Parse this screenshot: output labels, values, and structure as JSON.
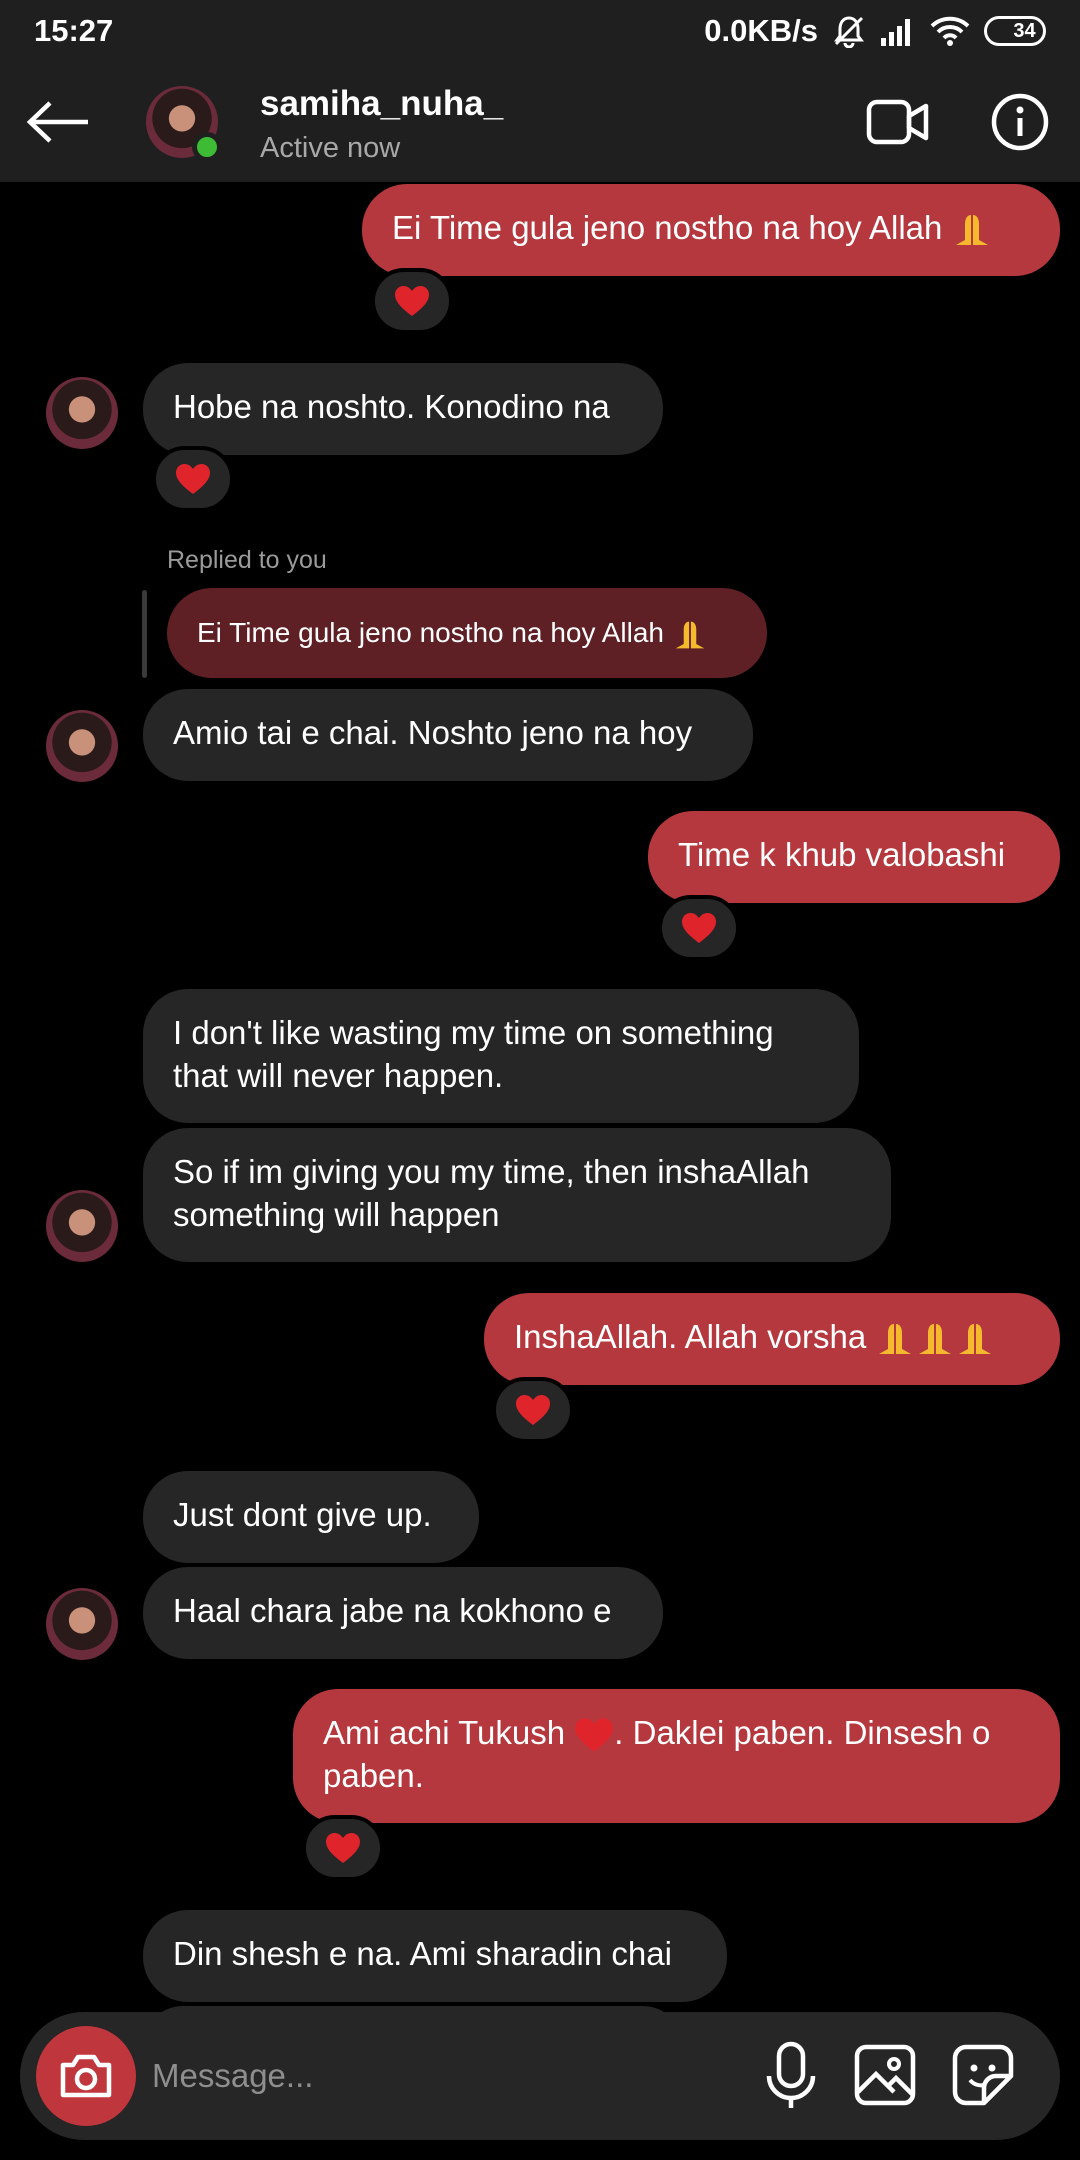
{
  "status_bar": {
    "time": "15:27",
    "network_speed": "0.0KB/s",
    "battery": "34",
    "battery_level": 0.34
  },
  "header": {
    "username": "samiha_nuha_",
    "status": "Active now",
    "online_color": "#3dbb35"
  },
  "colors": {
    "sent_bubble": "#b5383e",
    "received_bubble": "#262626",
    "quoted_bubble": "#5e2025",
    "camera_button": "#c0363d"
  },
  "messages": [
    {
      "direction": "sent",
      "text": "Ei Time gula jeno nostho na hoy Allah",
      "emoji": "folded-hands",
      "reaction": "heart"
    },
    {
      "direction": "received",
      "text": "Hobe na noshto. Konodino na",
      "reaction": "heart"
    },
    {
      "direction": "received",
      "reply_label": "Replied to you",
      "quoted_text": "Ei Time gula jeno nostho na hoy Allah",
      "text": "Amio tai e chai. Noshto jeno na hoy"
    },
    {
      "direction": "sent",
      "text": "Time k khub valobashi",
      "reaction": "heart"
    },
    {
      "direction": "received",
      "text": "I don't like wasting my time on something that will never happen."
    },
    {
      "direction": "received",
      "text": "So if im giving you my time, then inshaAllah something will happen"
    },
    {
      "direction": "sent",
      "text": "InshaAllah. Allah vorsha",
      "emoji": "folded-hands x3",
      "reaction": "heart"
    },
    {
      "direction": "received",
      "text": "Just dont give up."
    },
    {
      "direction": "received",
      "text": "Haal chara jabe na kokhono e"
    },
    {
      "direction": "sent",
      "text_part1": "Ami achi Tukush",
      "text_part2": ". Daklei paben. Dinsesh o paben.",
      "emoji": "heart",
      "reaction": "heart"
    },
    {
      "direction": "received",
      "text": "Din shesh e na. Ami sharadin chai"
    }
  ],
  "composer": {
    "placeholder": "Message..."
  },
  "icons": {
    "back": "arrow-left",
    "video": "video-camera",
    "info": "info-circle",
    "camera": "camera",
    "mic": "microphone",
    "gallery": "image",
    "sticker": "sticker"
  }
}
